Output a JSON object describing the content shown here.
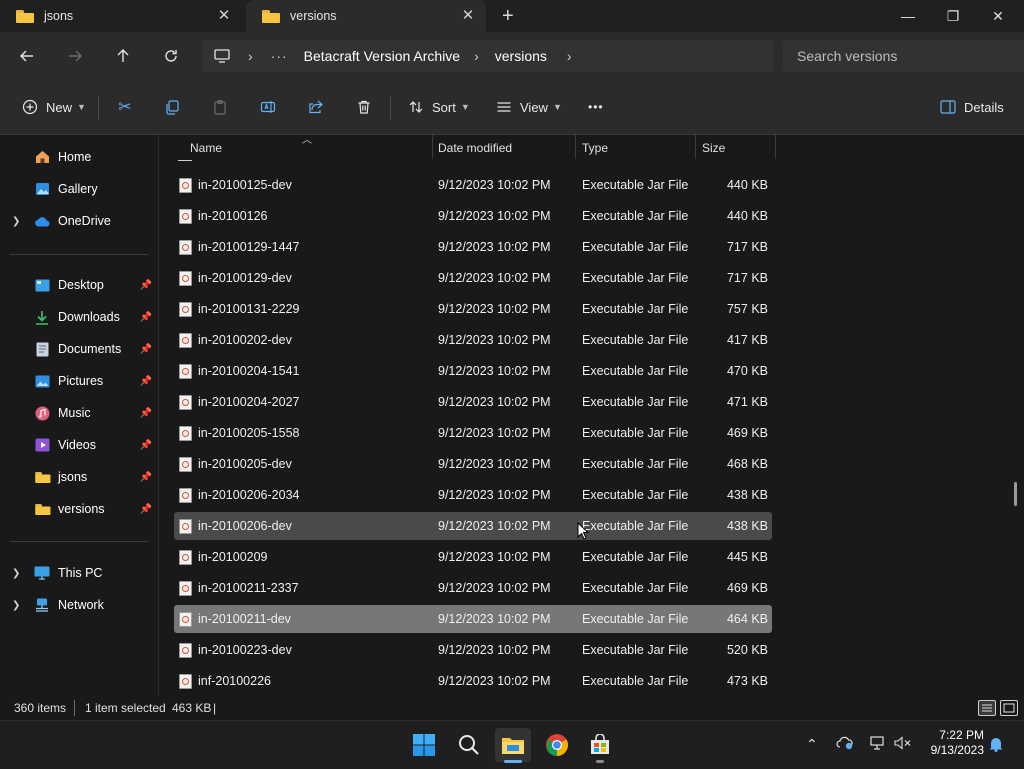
{
  "tabs": [
    {
      "label": "jsons",
      "active": false
    },
    {
      "label": "versions",
      "active": true
    }
  ],
  "new_tab_symbol": "+",
  "window_controls": {
    "minimize": "—",
    "maximize": "❐",
    "close": "✕"
  },
  "breadcrumbs": [
    "Betacraft Version Archive",
    "versions"
  ],
  "search": {
    "placeholder": "Search versions"
  },
  "toolbar": {
    "new_label": "New",
    "sort_label": "Sort",
    "view_label": "View",
    "more_label": "•••",
    "details_label": "Details"
  },
  "sidebar": {
    "home": "Home",
    "gallery": "Gallery",
    "onedrive": "OneDrive",
    "pinned": [
      "Desktop",
      "Downloads",
      "Documents",
      "Pictures",
      "Music",
      "Videos",
      "jsons",
      "versions"
    ],
    "thispc": "This PC",
    "network": "Network"
  },
  "columns": {
    "name": "Name",
    "date": "Date modified",
    "type": "Type",
    "size": "Size"
  },
  "files": [
    {
      "name": "in-20100125-dev",
      "date": "9/12/2023 10:02 PM",
      "type": "Executable Jar File",
      "size": "440 KB",
      "state": ""
    },
    {
      "name": "in-20100126",
      "date": "9/12/2023 10:02 PM",
      "type": "Executable Jar File",
      "size": "440 KB",
      "state": ""
    },
    {
      "name": "in-20100129-1447",
      "date": "9/12/2023 10:02 PM",
      "type": "Executable Jar File",
      "size": "717 KB",
      "state": ""
    },
    {
      "name": "in-20100129-dev",
      "date": "9/12/2023 10:02 PM",
      "type": "Executable Jar File",
      "size": "717 KB",
      "state": ""
    },
    {
      "name": "in-20100131-2229",
      "date": "9/12/2023 10:02 PM",
      "type": "Executable Jar File",
      "size": "757 KB",
      "state": ""
    },
    {
      "name": "in-20100202-dev",
      "date": "9/12/2023 10:02 PM",
      "type": "Executable Jar File",
      "size": "417 KB",
      "state": ""
    },
    {
      "name": "in-20100204-1541",
      "date": "9/12/2023 10:02 PM",
      "type": "Executable Jar File",
      "size": "470 KB",
      "state": ""
    },
    {
      "name": "in-20100204-2027",
      "date": "9/12/2023 10:02 PM",
      "type": "Executable Jar File",
      "size": "471 KB",
      "state": ""
    },
    {
      "name": "in-20100205-1558",
      "date": "9/12/2023 10:02 PM",
      "type": "Executable Jar File",
      "size": "469 KB",
      "state": ""
    },
    {
      "name": "in-20100205-dev",
      "date": "9/12/2023 10:02 PM",
      "type": "Executable Jar File",
      "size": "468 KB",
      "state": ""
    },
    {
      "name": "in-20100206-2034",
      "date": "9/12/2023 10:02 PM",
      "type": "Executable Jar File",
      "size": "438 KB",
      "state": ""
    },
    {
      "name": "in-20100206-dev",
      "date": "9/12/2023 10:02 PM",
      "type": "Executable Jar File",
      "size": "438 KB",
      "state": "hover"
    },
    {
      "name": "in-20100209",
      "date": "9/12/2023 10:02 PM",
      "type": "Executable Jar File",
      "size": "445 KB",
      "state": ""
    },
    {
      "name": "in-20100211-2337",
      "date": "9/12/2023 10:02 PM",
      "type": "Executable Jar File",
      "size": "469 KB",
      "state": ""
    },
    {
      "name": "in-20100211-dev",
      "date": "9/12/2023 10:02 PM",
      "type": "Executable Jar File",
      "size": "464 KB",
      "state": "sel"
    },
    {
      "name": "in-20100223-dev",
      "date": "9/12/2023 10:02 PM",
      "type": "Executable Jar File",
      "size": "520 KB",
      "state": ""
    },
    {
      "name": "inf-20100226",
      "date": "9/12/2023 10:02 PM",
      "type": "Executable Jar File",
      "size": "473 KB",
      "state": ""
    }
  ],
  "status": {
    "items": "360 items",
    "selected": "1 item selected",
    "selected_size": "463 KB",
    "separator": "|"
  },
  "clock": {
    "time": "7:22 PM",
    "date": "9/13/2023"
  },
  "colors": {
    "selection": "#777777",
    "hover": "#4a4a4a",
    "accent": "#5fb2f7",
    "folder": "#f4c542"
  }
}
